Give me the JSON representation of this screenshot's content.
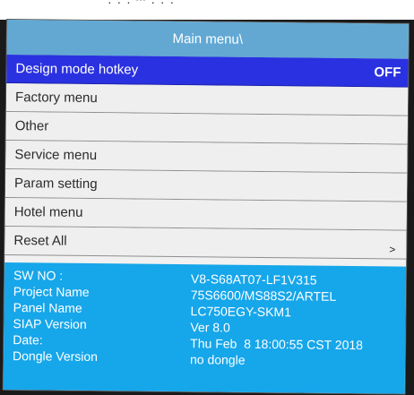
{
  "top_fragment": "· · · ‘‘‘ · · ·",
  "header": {
    "title": "Main menu\\"
  },
  "menu": {
    "items": [
      {
        "label": "Design mode hotkey",
        "value": "OFF",
        "selected": true
      },
      {
        "label": "Factory menu"
      },
      {
        "label": "Other"
      },
      {
        "label": "Service menu"
      },
      {
        "label": "Param setting"
      },
      {
        "label": "Hotel menu"
      },
      {
        "label": "Reset All",
        "chevron": ">"
      }
    ]
  },
  "info": {
    "rows": [
      {
        "key": "SW NO :",
        "value": "V8-S68AT07-LF1V315"
      },
      {
        "key": "Project Name",
        "value": "75S6600/MS88S2/ARTEL"
      },
      {
        "key": "Panel Name",
        "value": "LC750EGY-SKM1"
      },
      {
        "key": "SIAP Version",
        "value": "Ver 8.0"
      },
      {
        "key": "Date:",
        "value": "Thu Feb  8 18:00:55 CST 2018"
      },
      {
        "key": "Dongle Version",
        "value": "no dongle"
      }
    ]
  },
  "colors": {
    "header": "#62a8d3",
    "selected_row": "#2a31e0",
    "info_panel": "#16a6ea",
    "menu_bg": "#efefef"
  }
}
